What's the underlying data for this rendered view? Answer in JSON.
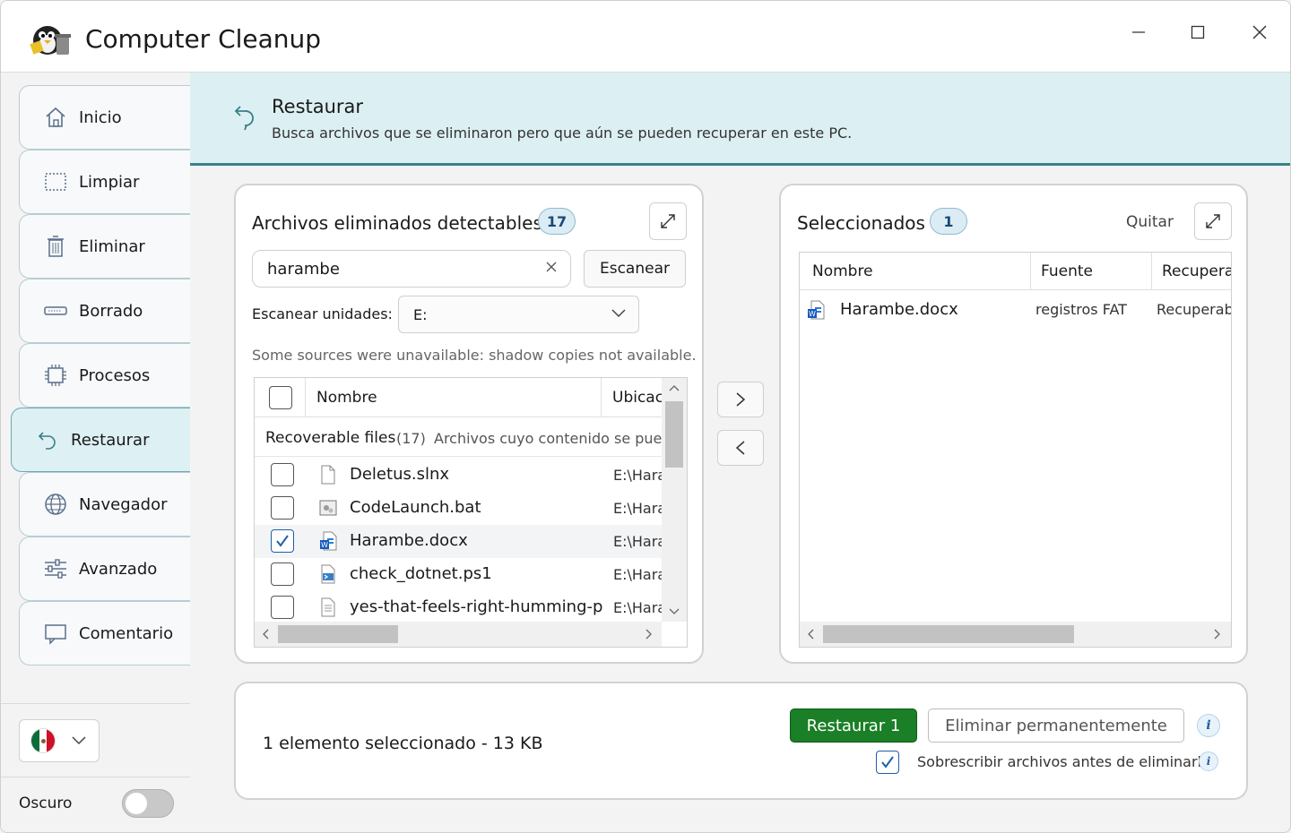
{
  "app": {
    "title": "Computer Cleanup"
  },
  "sidebar": {
    "items": [
      {
        "label": "Inicio",
        "icon": "home-icon"
      },
      {
        "label": "Limpiar",
        "icon": "broom-icon"
      },
      {
        "label": "Eliminar",
        "icon": "trash-icon"
      },
      {
        "label": "Borrado",
        "icon": "eraser-icon"
      },
      {
        "label": "Procesos",
        "icon": "cpu-icon"
      },
      {
        "label": "Restaurar",
        "icon": "restore-icon"
      },
      {
        "label": "Navegador",
        "icon": "globe-icon"
      },
      {
        "label": "Avanzado",
        "icon": "sliders-icon"
      },
      {
        "label": "Comentario",
        "icon": "comment-icon"
      }
    ],
    "active": "Restaurar",
    "language": "Español (México)",
    "dark_label": "Oscuro",
    "dark_enabled": false
  },
  "header": {
    "title": "Restaurar",
    "subtitle": "Busca archivos que se eliminaron pero que aún se pueden recuperar en este PC."
  },
  "left_panel": {
    "title": "Archivos eliminados detectables",
    "count": "17",
    "search_value": "harambe",
    "scan_button": "Escanear",
    "drive_label": "Escanear unidades:",
    "drive_value": "E:",
    "warning": "Some sources were unavailable: shadow copies not available.",
    "columns": {
      "name": "Nombre",
      "location": "Ubicac"
    },
    "group": {
      "name": "Recoverable files",
      "count": "(17)",
      "desc": "Archivos cuyo contenido se puede"
    },
    "rows": [
      {
        "name": "Deletus.slnx",
        "location": "E:\\Hara",
        "checked": false,
        "icon": "file-icon"
      },
      {
        "name": "CodeLaunch.bat",
        "location": "E:\\Hara",
        "checked": false,
        "icon": "batch-file-icon"
      },
      {
        "name": "Harambe.docx",
        "location": "E:\\Hara",
        "checked": true,
        "icon": "word-doc-icon"
      },
      {
        "name": "check_dotnet.ps1",
        "location": "E:\\Hara",
        "checked": false,
        "icon": "powershell-file-icon"
      },
      {
        "name": "yes-that-feels-right-humming-p",
        "location": "E:\\Hara",
        "checked": false,
        "icon": "text-file-icon"
      }
    ]
  },
  "right_panel": {
    "title": "Seleccionados",
    "count": "1",
    "remove_button": "Quitar",
    "columns": {
      "name": "Nombre",
      "source": "Fuente",
      "recovery": "Recupera"
    },
    "rows": [
      {
        "name": "Harambe.docx",
        "source": "registros FAT",
        "recovery": "Recuperab",
        "icon": "word-doc-icon"
      }
    ]
  },
  "footer": {
    "status": "1 elemento seleccionado - 13 KB",
    "restore_button": "Restaurar 1",
    "delete_button": "Eliminar permanentemente",
    "overwrite_label": "Sobrescribir archivos antes de eliminarlos",
    "overwrite_checked": true,
    "info_glyph": "i"
  },
  "colors": {
    "accent": "#3b7f8a",
    "header_bg": "#dcf0f3",
    "restore_green": "#1a7f26",
    "check_blue": "#1f5fa8"
  }
}
